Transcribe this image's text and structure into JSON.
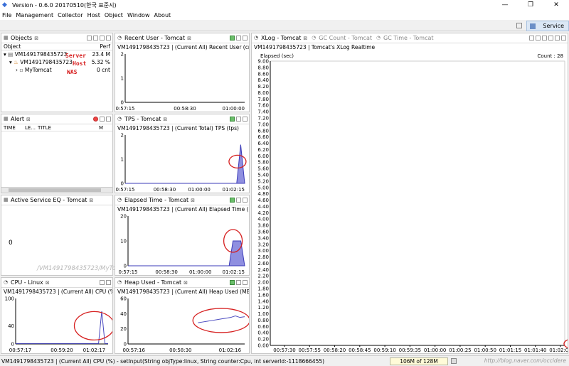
{
  "window": {
    "title": "Version - 0.6.0 20170510(한국 표준시)",
    "minimize": "—",
    "restore": "❐",
    "close": "✕"
  },
  "menu": [
    "File",
    "Management",
    "Collector",
    "Host",
    "Object",
    "Window",
    "About"
  ],
  "perspective": {
    "label": "Service"
  },
  "objects": {
    "tab": "Objects",
    "col_object": "Object",
    "col_perf": "Perf",
    "rows": [
      {
        "name": "VM1491798435723",
        "value": "23.4 M",
        "annotation": "Server"
      },
      {
        "name": "VM1491798435723",
        "value": "5.32 %",
        "annotation": "Host"
      },
      {
        "name": "MyTomcat",
        "value": "0 cnt",
        "annotation": "WAS"
      }
    ]
  },
  "alert": {
    "tab": "Alert",
    "cols": [
      "TIME",
      "LE...",
      "TITLE",
      "M"
    ]
  },
  "active_service": {
    "tab": "Active Service EQ - Tomcat",
    "value": "0",
    "watermark": "/VM1491798435723/MyTomcat"
  },
  "cpu": {
    "tab": "CPU - Linux",
    "subtitle": "VM1491798435723 | (Current All) CPU (%)"
  },
  "recent_user": {
    "tab": "Recent User - Tomcat",
    "subtitle": "VM1491798435723 | (Current All) Recent User (cnt)"
  },
  "tps": {
    "tab": "TPS - Tomcat",
    "subtitle": "VM1491798435723 | (Current Total) TPS (tps)"
  },
  "elapsed": {
    "tab": "Elapsed Time - Tomcat",
    "subtitle": "VM1491798435723 | (Current All) Elapsed Time (ms)"
  },
  "heap_used": {
    "tab": "Heap Used - Tomcat",
    "subtitle": "VM1491798435723 | (Current All) Heap Used (MB)"
  },
  "xlog": {
    "tabs": [
      "XLog - Tomcat",
      "GC Count - Tomcat",
      "GC Time - Tomcat"
    ],
    "subtitle": "VM1491798435723 | Tomcat's XLog Realtime",
    "ylabel": "Elapsed (sec)",
    "count": "Count : 28"
  },
  "status": {
    "text": "VM1491798435723 | (Current All) CPU (%) - setInput(String objType:linux, String counter:Cpu, int serverId:-1118666455)",
    "heap": "106M of 128M",
    "watermark": "http://blog.naver.com/occidere"
  },
  "chart_data": [
    {
      "type": "line",
      "title": "VM1491798435723 | (Current All) Recent User (cnt)",
      "x": [
        "00:57:15",
        "00:58:30",
        "01:00:00",
        "01:01:00",
        "01:02:15"
      ],
      "xticks": [
        "0:57:15",
        "00:58:30",
        "01:00:00"
      ],
      "y": [
        0,
        0,
        0,
        0,
        0
      ],
      "ylim": [
        0,
        2
      ],
      "yticks": [
        0,
        1,
        2
      ]
    },
    {
      "type": "area",
      "title": "VM1491798435723 | (Current Total) TPS (tps)",
      "xticks": [
        "0:57:15",
        "00:58:30",
        "01:00:00",
        "01:02:15"
      ],
      "ylim": [
        0,
        2
      ],
      "yticks": [
        0,
        1,
        2
      ],
      "series": [
        {
          "values": [
            0,
            0,
            0,
            0,
            0,
            0,
            0,
            0,
            0,
            0,
            0,
            0,
            0,
            0,
            0,
            0,
            0,
            0,
            0,
            0,
            0,
            0,
            0,
            0,
            0,
            0,
            0,
            0,
            0,
            1.6,
            0
          ]
        }
      ]
    },
    {
      "type": "area",
      "title": "VM1491798435723 | (Current All) Elapsed Time (ms)",
      "xticks": [
        "0:57:15",
        "00:58:30",
        "01:00:00",
        "01:02:15"
      ],
      "ylim": [
        0,
        20
      ],
      "yticks": [
        0,
        10,
        20
      ],
      "series": [
        {
          "values": [
            0,
            0,
            0,
            0,
            0,
            0,
            0,
            0,
            0,
            0,
            0,
            0,
            0,
            0,
            0,
            0,
            0,
            0,
            0,
            0,
            0,
            0,
            0,
            0,
            0,
            0,
            0,
            10,
            10,
            10,
            0
          ]
        }
      ]
    },
    {
      "type": "line",
      "title": "VM1491798435723 | (Current All) CPU (%)",
      "xticks": [
        "00:57:17",
        "00:59:20",
        "01:02:17"
      ],
      "ylim": [
        0,
        100
      ],
      "yticks": [
        0,
        40,
        100
      ],
      "series": [
        {
          "values": [
            1,
            1,
            1,
            1,
            1,
            1,
            1,
            1,
            1,
            1,
            1,
            1,
            1,
            1,
            1,
            1,
            1,
            1,
            1,
            1,
            1,
            1,
            1,
            1,
            1,
            1,
            1,
            72,
            1,
            1
          ]
        }
      ]
    },
    {
      "type": "line",
      "title": "VM1491798435723 | (Current All) Heap Used (MB)",
      "xticks": [
        "00:57:16",
        "00:58:30",
        "01:02:16"
      ],
      "ylim": [
        0,
        60
      ],
      "yticks": [
        0,
        20,
        40,
        60
      ],
      "series": [
        {
          "values": [
            28,
            29,
            30,
            31,
            32,
            33,
            34,
            35,
            37,
            35,
            36
          ]
        }
      ]
    },
    {
      "type": "scatter",
      "title": "VM1491798435723 | Tomcat's XLog Realtime",
      "ylabel": "Elapsed (sec)",
      "xticks": [
        "00:57:30",
        "00:57:55",
        "00:58:20",
        "00:58:45",
        "00:59:10",
        "00:59:35",
        "01:00:00",
        "01:00:25",
        "01:00:50",
        "01:01:15",
        "01:01:40",
        "01:02:05"
      ],
      "ylim": [
        0,
        9
      ],
      "yticks": [
        0,
        0.2,
        0.4,
        0.6,
        0.8,
        1,
        1.2,
        1.4,
        1.6,
        1.8,
        2,
        2.2,
        2.4,
        2.6,
        2.8,
        3,
        3.2,
        3.4,
        3.6,
        3.8,
        4,
        4.2,
        4.4,
        4.6,
        4.8,
        5,
        5.2,
        5.4,
        5.6,
        5.8,
        6,
        6.2,
        6.4,
        6.6,
        6.8,
        7,
        7.2,
        7.4,
        7.6,
        7.8,
        8,
        8.2,
        8.4,
        8.6,
        8.8,
        9
      ],
      "points_near": [
        [
          11.5,
          0.02
        ],
        [
          11.7,
          0.03
        ],
        [
          11.8,
          0.02
        ]
      ]
    }
  ]
}
